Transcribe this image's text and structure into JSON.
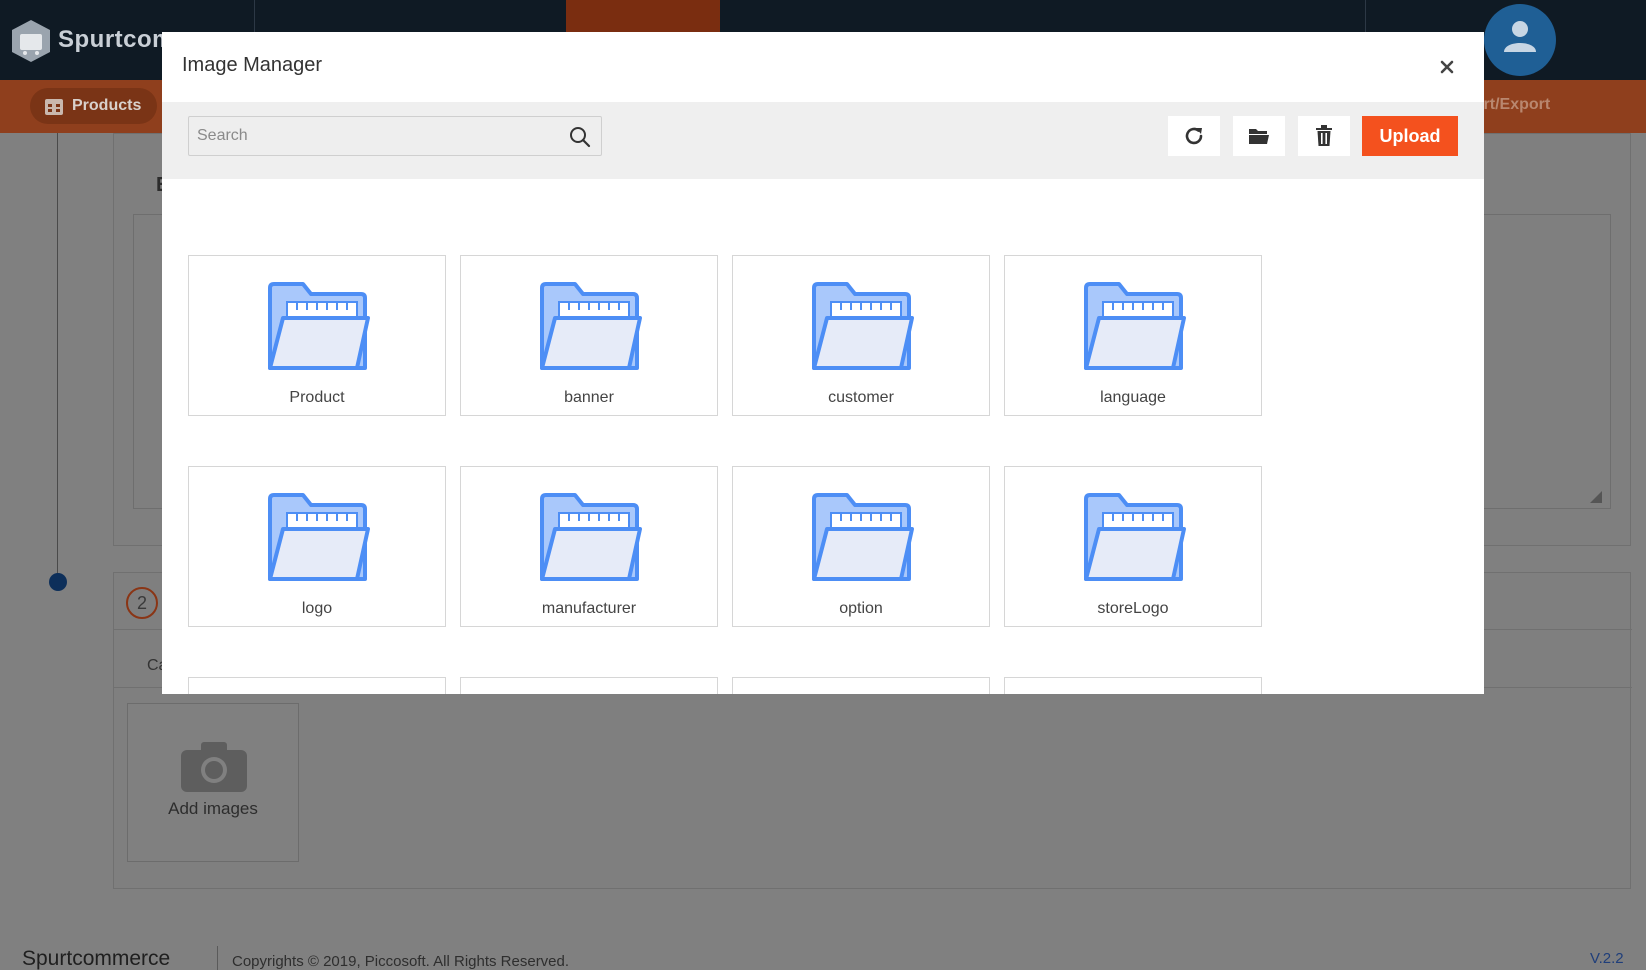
{
  "app": {
    "brand": "Spurtcom",
    "subnav_active": "Products",
    "subnav_right": "port/Export"
  },
  "background": {
    "card1_letter": "E",
    "step_number": "2",
    "card2_label": "Ca",
    "add_images_label": "Add images"
  },
  "footer": {
    "brand": "Spurtcommerce",
    "copyright": "Copyrights © 2019, Piccosoft. All Rights Reserved.",
    "version": "V.2.2"
  },
  "modal": {
    "title": "Image Manager",
    "close_symbol": "×",
    "search": {
      "placeholder": "Search",
      "value": ""
    },
    "upload_label": "Upload",
    "folders": [
      {
        "name": "Product"
      },
      {
        "name": "banner"
      },
      {
        "name": "customer"
      },
      {
        "name": "language"
      },
      {
        "name": "logo"
      },
      {
        "name": "manufacturer"
      },
      {
        "name": "option"
      },
      {
        "name": "storeLogo"
      }
    ]
  },
  "colors": {
    "accent": "#f4511e",
    "topbar": "#0f1a24",
    "folder_blue": "#4d8ef5"
  }
}
